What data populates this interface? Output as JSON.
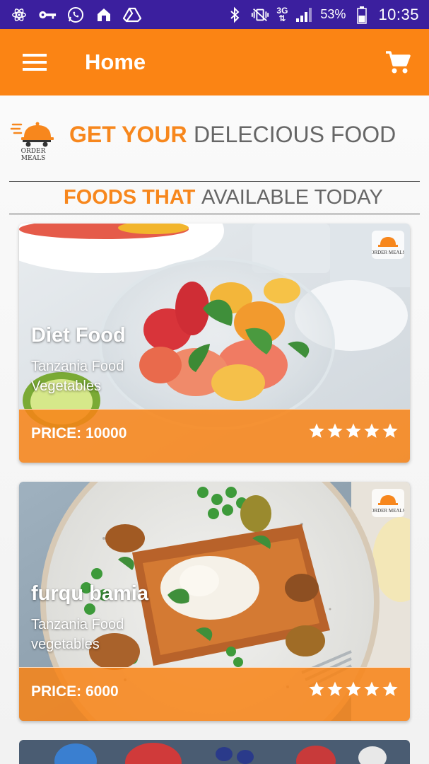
{
  "status_bar": {
    "network": "3G",
    "battery": "53%",
    "time": "10:35"
  },
  "app_bar": {
    "title": "Home",
    "menu_icon": "hamburger-icon",
    "cart_icon": "cart-icon"
  },
  "headline": {
    "logo_text": "ORDER MEALS",
    "strong": "GET YOUR",
    "light": "DELECIOUS FOOD"
  },
  "subheadline": {
    "strong": "FOODS THAT",
    "light": "AVAILABLE TODAY"
  },
  "foods": [
    {
      "name": "Diet Food",
      "origin": "Tanzania Food",
      "category": "Vegetables",
      "price": "PRICE: 10000",
      "rating": 5
    },
    {
      "name": "furqu bamia",
      "origin": "Tanzania Food",
      "category": "vegetables",
      "price": "PRICE: 6000",
      "rating": 5
    }
  ],
  "colors": {
    "status_bar": "#3b1f9e",
    "accent": "#fb8414",
    "heading_orange": "#f7871d",
    "heading_grey": "#666666"
  }
}
